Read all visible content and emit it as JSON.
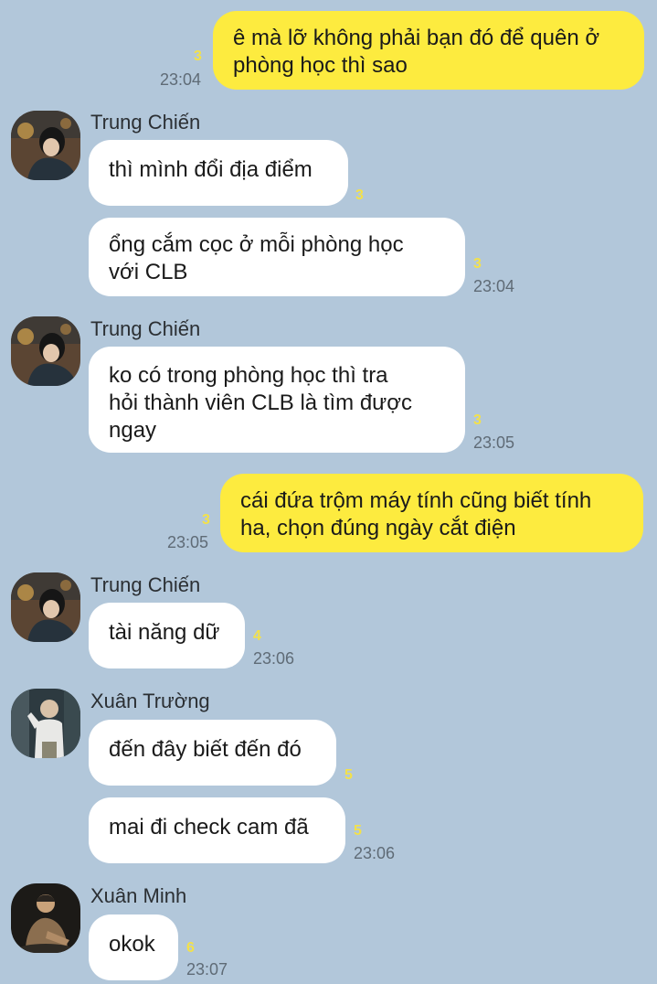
{
  "messages": [
    {
      "side": "me",
      "text": "ê mà lỡ không phải bạn đó để quên ở\nphòng học thì sao",
      "unread": "3",
      "time": "23:04"
    },
    {
      "side": "them",
      "sender": "Trung Chiến",
      "text": "thì mình đổi địa điểm",
      "unread": "3"
    },
    {
      "side": "them",
      "text": "ổng cắm cọc ở mỗi phòng học\nvới CLB",
      "unread": "3",
      "time": "23:04"
    },
    {
      "side": "them",
      "sender": "Trung Chiến",
      "text": "ko có trong phòng học thì tra\nhỏi thành viên CLB là tìm được\nngay",
      "unread": "3",
      "time": "23:05"
    },
    {
      "side": "me",
      "text": "cái đứa trộm máy tính cũng biết tính\nha, chọn đúng ngày cắt điện",
      "unread": "3",
      "time": "23:05"
    },
    {
      "side": "them",
      "sender": "Trung Chiến",
      "text": "tài năng dữ",
      "unread": "4",
      "time": "23:06"
    },
    {
      "side": "them",
      "sender": "Xuân Trường",
      "text": "đến đây biết đến đó",
      "unread": "5"
    },
    {
      "side": "them",
      "text": "mai đi check cam đã",
      "unread": "5",
      "time": "23:06"
    },
    {
      "side": "them",
      "sender": "Xuân Minh",
      "text": "okok",
      "unread": "6",
      "time": "23:07"
    }
  ],
  "avatars": [
    {
      "person": "Trung Chiến",
      "icon": "profile-photo-icon"
    },
    {
      "person": "Trung Chiến",
      "icon": "profile-photo-icon"
    },
    {
      "person": "Trung Chiến",
      "icon": "profile-photo-icon"
    },
    {
      "person": "Xuân Trường",
      "icon": "profile-photo-icon"
    },
    {
      "person": "Xuân Minh",
      "icon": "profile-photo-icon"
    }
  ],
  "colors": {
    "background": "#b2c7da",
    "my_bubble": "#fdeb3f",
    "their_bubble": "#ffffff",
    "unread_count": "#f3e14a",
    "timestamp": "#5f6b76"
  }
}
